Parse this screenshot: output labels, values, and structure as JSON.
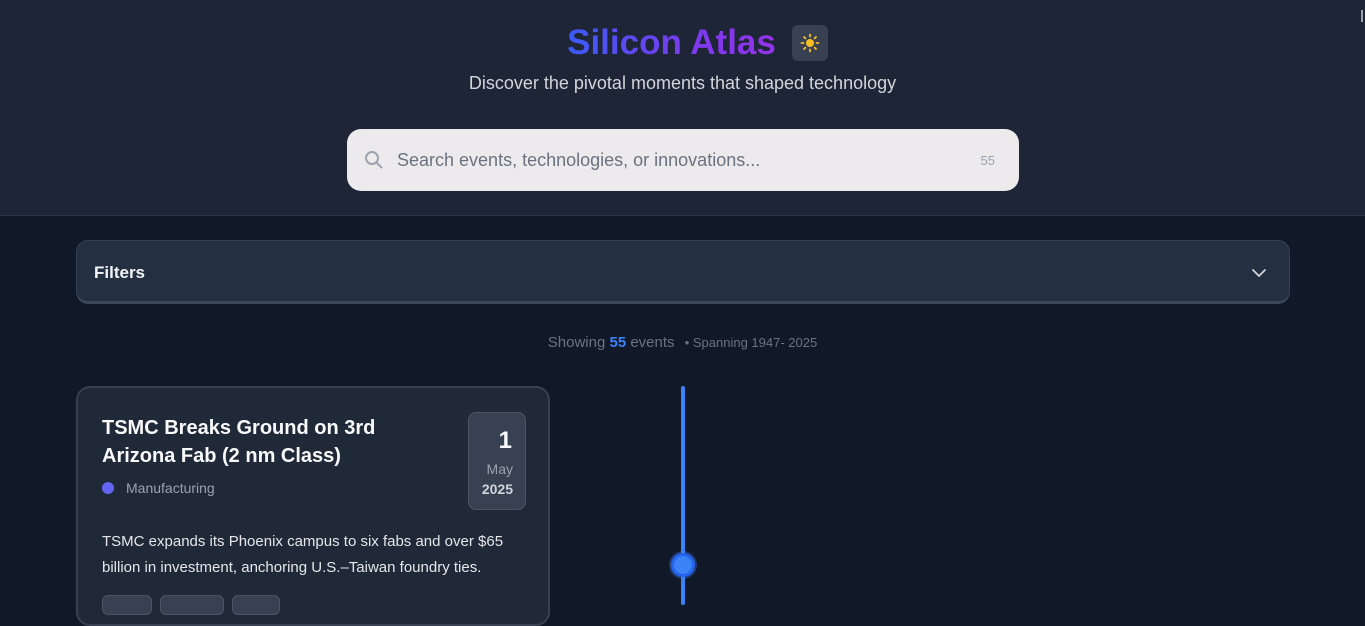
{
  "header": {
    "title": "Silicon Atlas",
    "subtitle": "Discover the pivotal moments that shaped technology",
    "theme_toggle_icon": "sun-icon"
  },
  "search": {
    "placeholder": "Search events, technologies, or innovations...",
    "value": "",
    "count": "55",
    "icon": "search-icon"
  },
  "filters": {
    "label": "Filters",
    "icon": "chevron-down-icon"
  },
  "summary": {
    "prefix": "Showing",
    "count": "55",
    "suffix": "events",
    "span": "• Spanning 1947- 2025"
  },
  "events": [
    {
      "title": "TSMC Breaks Ground on 3rd Arizona Fab (2 nm Class)",
      "category": "Manufacturing",
      "category_color": "#6366f1",
      "day": "1",
      "month": "May",
      "year": "2025",
      "description": "TSMC expands its Phoenix campus to six fabs and over $65 billion in investment, anchoring U.S.–Taiwan foundry ties.",
      "tags": [
        "",
        "",
        ""
      ]
    }
  ],
  "colors": {
    "accent": "#3b82f6",
    "title_gradient_start": "#3b5bf6",
    "title_gradient_end": "#9333ea",
    "background": "#111827",
    "header_bg": "#1e2536"
  }
}
